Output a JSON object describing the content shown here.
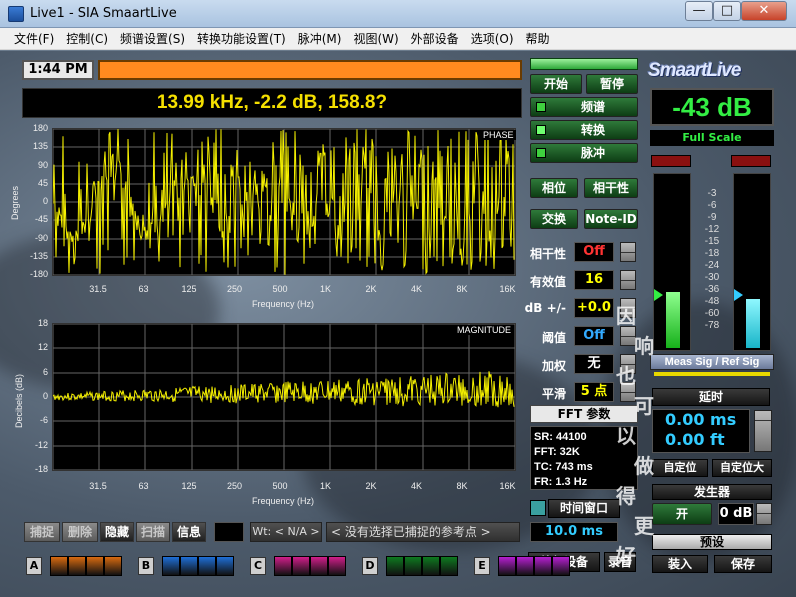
{
  "window": {
    "title": "Live1 - SIA SmaartLive",
    "minimize": "—",
    "maximize": "□",
    "close": "✕"
  },
  "menu": [
    "文件(F)",
    "控制(C)",
    "频谱设置(S)",
    "转换功能设置(T)",
    "脉冲(M)",
    "视图(W)",
    "外部设备",
    "选项(O)",
    "帮助"
  ],
  "clock": "1:44 PM",
  "readout": "13.99 kHz, -2.2 dB, 158.8?",
  "phase_plot": {
    "title": "PHASE",
    "ylabel": "Degrees",
    "xlabel": "Frequency (Hz)",
    "yticks": [
      "180",
      "135",
      "90",
      "45",
      "0",
      "-45",
      "-90",
      "-135",
      "-180"
    ],
    "xticks": [
      "31.5",
      "63",
      "125",
      "250",
      "500",
      "1K",
      "2K",
      "4K",
      "8K",
      "16K"
    ]
  },
  "magnitude_plot": {
    "title": "MAGNITUDE",
    "ylabel": "Decibels (dB)",
    "xlabel": "Frequency (Hz)",
    "yticks": [
      "18",
      "12",
      "6",
      "0",
      "-6",
      "-12",
      "-18"
    ],
    "xticks": [
      "31.5",
      "63",
      "125",
      "250",
      "500",
      "1K",
      "2K",
      "4K",
      "8K",
      "16K"
    ]
  },
  "controls": {
    "start": "开始",
    "pause": "暂停",
    "spectrum": "频谱",
    "transfer": "转换",
    "impulse": "脉冲",
    "phase": "相位",
    "coherence": "相干性",
    "crossover": "交换",
    "note_id": "Note-ID"
  },
  "params": [
    {
      "label": "相干性",
      "value": "Off",
      "color": "#ff3333"
    },
    {
      "label": "有效值",
      "value": "16",
      "color": "#ffff00"
    },
    {
      "label": "dB +/-",
      "value": "+0.0",
      "color": "#ffff00"
    },
    {
      "label": "阈值",
      "value": "Off",
      "color": "#33aaff"
    },
    {
      "label": "加权",
      "value": "无",
      "color": "#ffffff"
    },
    {
      "label": "平滑",
      "value": "5 点",
      "color": "#ffff00"
    }
  ],
  "fft": {
    "title": "FFT 参数",
    "sr": "SR: 44100",
    "fft": "FFT: 32K",
    "tc": "TC: 743 ms",
    "fr": "FR: 1.3 Hz"
  },
  "time_window": {
    "label": "时间窗口",
    "value": "10.0 ms"
  },
  "external": "外部设备",
  "record": "录音",
  "level": {
    "value": "-43 dB",
    "scale": "Full Scale"
  },
  "meter_ticks": [
    "-3",
    "-6",
    "-9",
    "-12",
    "-15",
    "-18",
    "-24",
    "-30",
    "-36",
    "-48",
    "-60",
    "-78"
  ],
  "meter_levels": [
    0.32,
    0.28
  ],
  "meas_ref": "Meas Sig / Ref Sig",
  "delay": {
    "title": "延时",
    "ms": "0.00 ms",
    "ft": "0.00 ft",
    "locate": "自定位",
    "locate_big": "自定位大"
  },
  "generator": {
    "title": "发生器",
    "on": "开",
    "value": "0 dB",
    "preset": "预设"
  },
  "load": "装入",
  "save": "保存",
  "capture": {
    "capture": "捕捉",
    "delete": "删除",
    "hide": "隐藏",
    "scan": "扫描",
    "info": "信息",
    "wt": "Wt: < N/A >",
    "ref": "<  没有选择已捕捉的参考点  >"
  },
  "banks": [
    {
      "letter": "A",
      "color": "#d86a10"
    },
    {
      "letter": "B",
      "color": "#1f6fd6"
    },
    {
      "letter": "C",
      "color": "#d01e8a"
    },
    {
      "letter": "D",
      "color": "#0e7a20"
    },
    {
      "letter": "E",
      "color": "#b51fd0"
    }
  ],
  "logo": "SmaartLive",
  "watermark": [
    "因",
    "响",
    "也",
    "可",
    "以",
    "做",
    "得",
    "更",
    "好"
  ]
}
